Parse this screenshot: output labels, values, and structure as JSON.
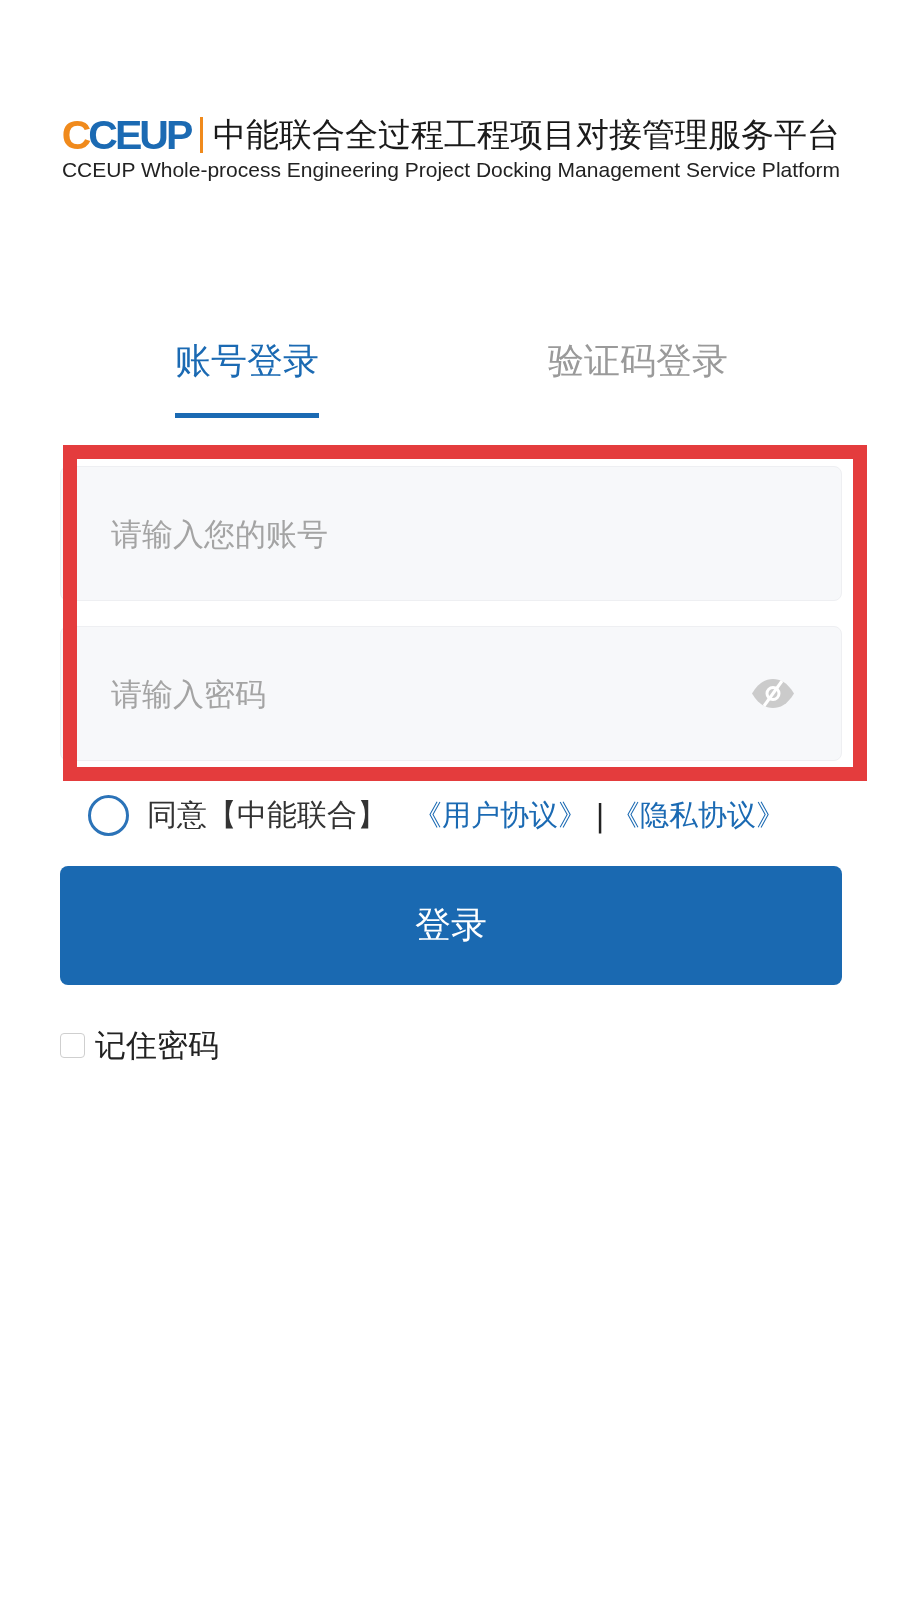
{
  "header": {
    "logo": "CCEUP",
    "title": "中能联合全过程工程项目对接管理服务平台",
    "subtitle": "CCEUP Whole-process Engineering Project Docking Management Service Platform"
  },
  "tabs": [
    {
      "label": "账号登录",
      "selected": true
    },
    {
      "label": "验证码登录",
      "selected": false
    }
  ],
  "fields": [
    {
      "kind": "account",
      "placeholder": "请输入您的账号"
    },
    {
      "kind": "password",
      "placeholder": "请输入密码"
    }
  ],
  "agreement": {
    "checked": false,
    "text": "同意【中能联合】",
    "links": [
      "《用户协议》",
      "《隐私协议》"
    ],
    "separator": "|"
  },
  "login_button": "登录",
  "remember": {
    "checked": false,
    "label": "记住密码"
  }
}
